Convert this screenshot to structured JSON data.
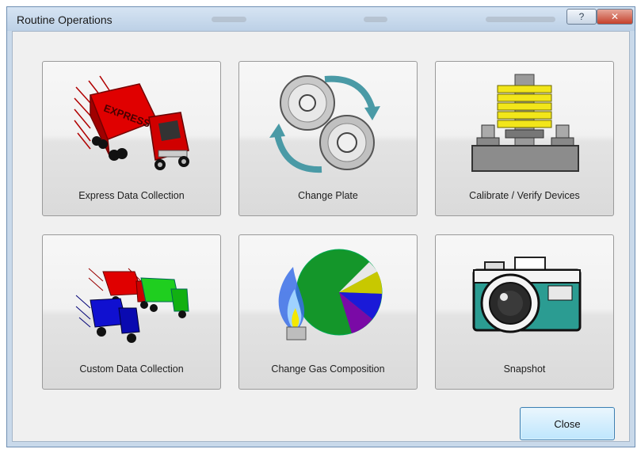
{
  "window": {
    "title": "Routine Operations",
    "help_label": "?",
    "close_label": "✕"
  },
  "tiles": [
    {
      "label": "Express Data Collection",
      "icon": "express-truck-icon"
    },
    {
      "label": "Change Plate",
      "icon": "change-plate-icon"
    },
    {
      "label": "Calibrate / Verify Devices",
      "icon": "calibration-weights-icon"
    },
    {
      "label": "Custom Data Collection",
      "icon": "trucks-icon"
    },
    {
      "label": "Change Gas Composition",
      "icon": "gas-flame-pie-icon"
    },
    {
      "label": "Snapshot",
      "icon": "camera-icon"
    }
  ],
  "truck_text": "EXPRESS",
  "close_button": {
    "label": "Close"
  },
  "colors": {
    "title_bar": "#bcd0e6",
    "client_bg": "#f0f0f0",
    "close_hover": "#bee6fd"
  }
}
